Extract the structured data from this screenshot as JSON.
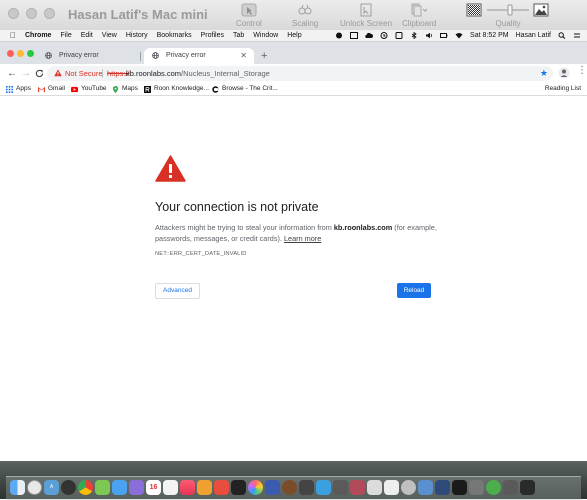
{
  "screen_sharing": {
    "window_title": "Hasan Latif's Mac mini",
    "tools": [
      {
        "icon": "control-icon",
        "label": "Control"
      },
      {
        "icon": "scaling-icon",
        "label": "Scaling"
      },
      {
        "icon": "unlock-screen-icon",
        "label": "Unlock Screen"
      },
      {
        "icon": "clipboard-icon",
        "label": "Clipboard"
      },
      {
        "icon": "quality-icon",
        "label": "Quality"
      }
    ]
  },
  "menubar": {
    "items": [
      "Chrome",
      "File",
      "Edit",
      "View",
      "History",
      "Bookmarks",
      "Profiles",
      "Tab",
      "Window",
      "Help"
    ],
    "clock": "Sat 8:52 PM",
    "user": "Hasan Latif"
  },
  "tabs": [
    {
      "title": "Privacy error",
      "active": false
    },
    {
      "title": "Privacy error",
      "active": true
    }
  ],
  "toolbar": {
    "security_label": "Not Secure",
    "url_scheme": "https://",
    "url_host": "kb.roonlabs.com",
    "url_path": "/Nucleus_Internal_Storage"
  },
  "bookmarks": [
    {
      "label": "Apps",
      "icon": "apps-grid-icon"
    },
    {
      "label": "Gmail",
      "icon": "gmail-icon"
    },
    {
      "label": "YouTube",
      "icon": "youtube-icon"
    },
    {
      "label": "Maps",
      "icon": "maps-icon"
    },
    {
      "label": "Roon Knowledge...",
      "icon": "roon-icon"
    },
    {
      "label": "Browse - The Crit...",
      "icon": "criterion-icon"
    }
  ],
  "reading_list": "Reading List",
  "error_page": {
    "heading": "Your connection is not private",
    "text_before": "Attackers might be trying to steal your information from ",
    "host": "kb.roonlabs.com",
    "text_after": " (for example, passwords, messages, or credit cards). ",
    "learn_more": "Learn more",
    "error_code": "NET::ERR_CERT_DATE_INVALID",
    "advanced_button": "Advanced",
    "reload_button": "Reload"
  },
  "colors": {
    "accent_blue": "#1a73e8",
    "warning_red": "#d93025"
  },
  "dock": {
    "calendar_day": "16"
  }
}
